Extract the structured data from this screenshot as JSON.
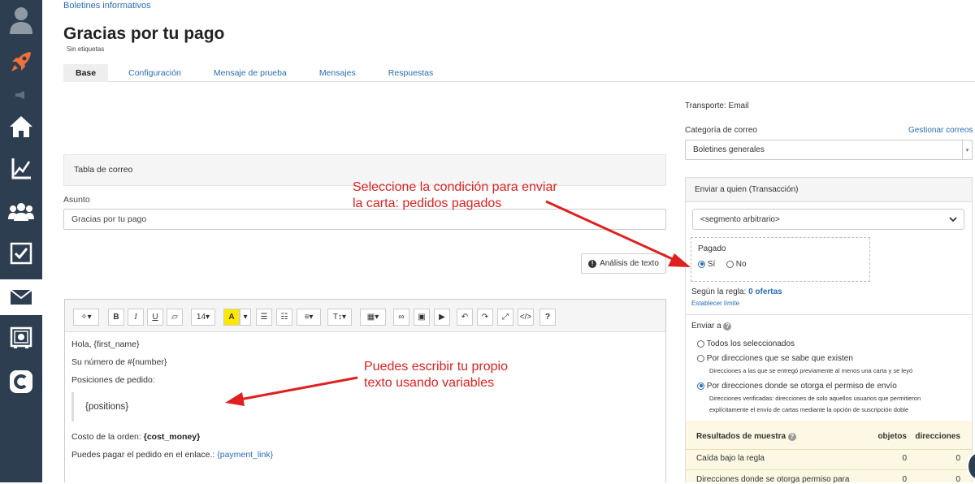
{
  "sidebar": {
    "items": [
      {
        "name": "user-avatar-icon"
      },
      {
        "name": "rocket-icon"
      },
      {
        "name": "megaphone-icon"
      },
      {
        "name": "home-icon"
      },
      {
        "name": "chart-icon"
      },
      {
        "name": "users-icon"
      },
      {
        "name": "checklist-icon"
      },
      {
        "name": "mail-icon",
        "active": true
      },
      {
        "name": "safe-icon"
      },
      {
        "name": "brand-c-icon"
      }
    ]
  },
  "header": {
    "breadcrumb": "Boletines informativos",
    "title": "Gracias por tu pago",
    "tags": "Sin etiquetas"
  },
  "tabs": [
    {
      "label": "Base",
      "active": true
    },
    {
      "label": "Configuración"
    },
    {
      "label": "Mensaje de prueba"
    },
    {
      "label": "Mensajes"
    },
    {
      "label": "Respuestas"
    }
  ],
  "left": {
    "table_label": "Tabla de correo",
    "subject_label": "Asunto",
    "subject_value": "Gracias por tu pago",
    "analysis_button": "Análisis de texto"
  },
  "toolbar": {
    "font_size": "14",
    "highlight": "A",
    "text_tool": "T"
  },
  "editor": {
    "line1": "Hola, {first_name}",
    "line2": "Su número de #{number}",
    "line3": "Posiciones de pedido:",
    "positions": "{positions}",
    "cost_prefix": "Costo de la orden: ",
    "cost_var": "{cost_money}",
    "pay_prefix": "Puedes pagar el pedido en el enlace.: ",
    "pay_var": "{payment_link}"
  },
  "right": {
    "transport": "Transporte: Email",
    "category_label": "Categoría de correo",
    "manage_link": "Gestionar correos",
    "category_value": "Boletines generales",
    "send_to_heading": "Enviar a quien (Transacción)",
    "segment_value": "<segmento arbitrario>",
    "paid_label": "Pagado",
    "paid_yes": "Sí",
    "paid_no": "No",
    "rule_prefix": "Según la regla: ",
    "rule_count": "0 ofertas",
    "set_limit": "Establecer límite",
    "send_a_label": "Enviar a",
    "option_all": "Todos los seleccionados",
    "option_known": "Por direcciones que se sabe que existen",
    "option_known_desc": "Direcciones a las que se entregó previamente al menos una carta y se leyó",
    "option_permission": "Por direcciones donde se otorga el permiso de envío",
    "option_permission_desc1": "Direcciones verificadas: direcciones de solo aquellos usuarios que permitieron",
    "option_permission_desc2": "explícitamente el envío de cartas mediante la opción de suscripción doble"
  },
  "results": {
    "title": "Resultados de muestra",
    "col_objects": "objetos",
    "col_addresses": "direcciones",
    "rows": [
      {
        "label": "Caída bajo la regla",
        "objects": "0",
        "addresses": "0"
      },
      {
        "label": "Direcciones donde se otorga permiso para",
        "objects": "0",
        "addresses": "0"
      }
    ]
  },
  "annotations": {
    "note1_line1": "Seleccione la condición para enviar",
    "note1_line2": "la carta: pedidos pagados",
    "note2_line1": "Puedes escribir tu propio",
    "note2_line2": "texto usando variables",
    "color": "#e02020"
  }
}
